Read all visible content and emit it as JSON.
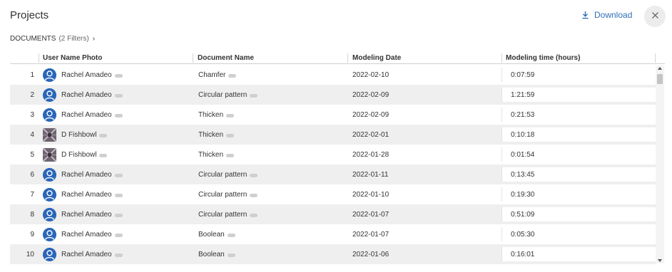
{
  "header": {
    "title": "Projects",
    "download_label": "Download",
    "download_icon": "download-icon",
    "close_icon": "close-icon",
    "accent_color": "#2f6fb5"
  },
  "breadcrumb": {
    "label": "DOCUMENTS",
    "filters": "(2 Filters)",
    "chevron": "›"
  },
  "table": {
    "columns": [
      "User Name Photo",
      "Document Name",
      "Modeling Date",
      "Modeling time (hours)"
    ],
    "rows": [
      {
        "num": "1",
        "user": "Rachel Amadeo",
        "avatar": "default",
        "document": "Chamfer",
        "date": "2022-02-10",
        "time": "0:07:59"
      },
      {
        "num": "2",
        "user": "Rachel Amadeo",
        "avatar": "default",
        "document": "Circular pattern",
        "date": "2022-02-09",
        "time": "1:21:59"
      },
      {
        "num": "3",
        "user": "Rachel Amadeo",
        "avatar": "default",
        "document": "Thicken",
        "date": "2022-02-09",
        "time": "0:21:53"
      },
      {
        "num": "4",
        "user": "D Fishbowl",
        "avatar": "photo",
        "document": "Thicken",
        "date": "2022-02-01",
        "time": "0:10:18"
      },
      {
        "num": "5",
        "user": "D Fishbowl",
        "avatar": "photo",
        "document": "Thicken",
        "date": "2022-01-28",
        "time": "0:01:54"
      },
      {
        "num": "6",
        "user": "Rachel Amadeo",
        "avatar": "default",
        "document": "Circular pattern",
        "date": "2022-01-11",
        "time": "0:13:45"
      },
      {
        "num": "7",
        "user": "Rachel Amadeo",
        "avatar": "default",
        "document": "Circular pattern",
        "date": "2022-01-10",
        "time": "0:19:30"
      },
      {
        "num": "8",
        "user": "Rachel Amadeo",
        "avatar": "default",
        "document": "Circular pattern",
        "date": "2022-01-07",
        "time": "0:51:09"
      },
      {
        "num": "9",
        "user": "Rachel Amadeo",
        "avatar": "default",
        "document": "Boolean",
        "date": "2022-01-07",
        "time": "0:05:30"
      },
      {
        "num": "10",
        "user": "Rachel Amadeo",
        "avatar": "default",
        "document": "Boolean",
        "date": "2022-01-06",
        "time": "0:16:01"
      }
    ]
  }
}
